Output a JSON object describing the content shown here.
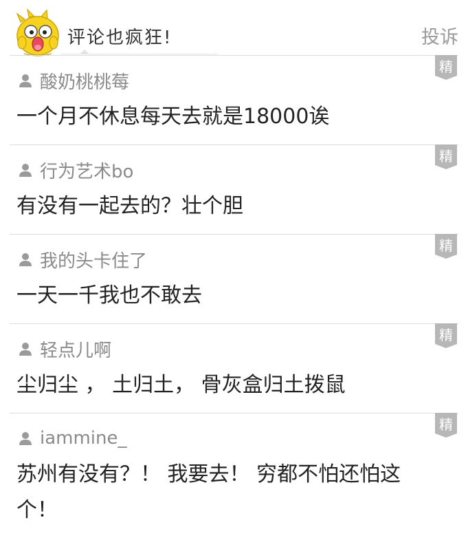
{
  "header": {
    "title": "评论也疯狂!",
    "report_label": "投诉"
  },
  "badge_label": "精",
  "comments": [
    {
      "username": "酸奶桃桃莓",
      "text": "一个月不休息每天去就是18000诶"
    },
    {
      "username": "行为艺术bo",
      "text": "有没有一起去的？壮个胆"
    },
    {
      "username": " 我的头卡住了",
      "text": "一天一千我也不敢去"
    },
    {
      "username": "轻点儿啊",
      "text": "尘归尘 ， 土归土， 骨灰盒归土拨鼠"
    },
    {
      "username": "iammine_",
      "text": "苏州有没有？！ 我要去！ 穷都不怕还怕这个！"
    }
  ],
  "colors": {
    "username": "#8a8a8a",
    "badge": "#b7b7b7",
    "mascot": "#f7d21e",
    "divider": "#dcdcdc"
  },
  "icons": [
    "mascot-icon",
    "user-icon",
    "featured-badge-icon"
  ]
}
